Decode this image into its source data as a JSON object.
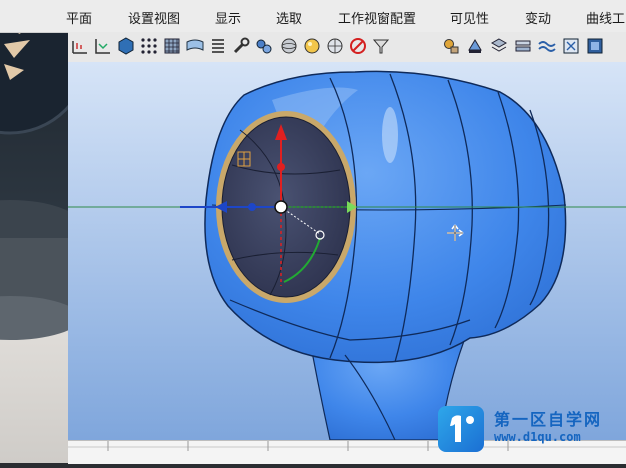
{
  "menubar": {
    "items": [
      {
        "label": "平面"
      },
      {
        "label": "设置视图"
      },
      {
        "label": "显示"
      },
      {
        "label": "选取"
      },
      {
        "label": "工作视窗配置"
      },
      {
        "label": "可见性"
      },
      {
        "label": "变动"
      },
      {
        "label": "曲线工"
      }
    ]
  },
  "toolbar": {
    "icons": [
      "grid-plane-icon",
      "axis-grid-icon",
      "shaded-box-icon",
      "point-grid-icon",
      "mesh-grid-icon",
      "ribbon-icon",
      "list-icon",
      "wrench-icon",
      "gears-icon",
      "sphere-icon",
      "shaded-sphere-icon",
      "sphere-outline-icon",
      "no-sphere-icon",
      "funnel-icon",
      "hand-gear-icon",
      "paint-bucket-icon",
      "layers-icon",
      "stack-icon",
      "wave-icon",
      "select-box-icon",
      "shade-box-icon"
    ]
  },
  "watermark": {
    "title": "第一区自学网",
    "url": "www.d1qu.com"
  },
  "colors": {
    "model": "#3f86ea",
    "viewport_top": "#d6e4f7",
    "viewport_bottom": "#7fa6dc"
  }
}
